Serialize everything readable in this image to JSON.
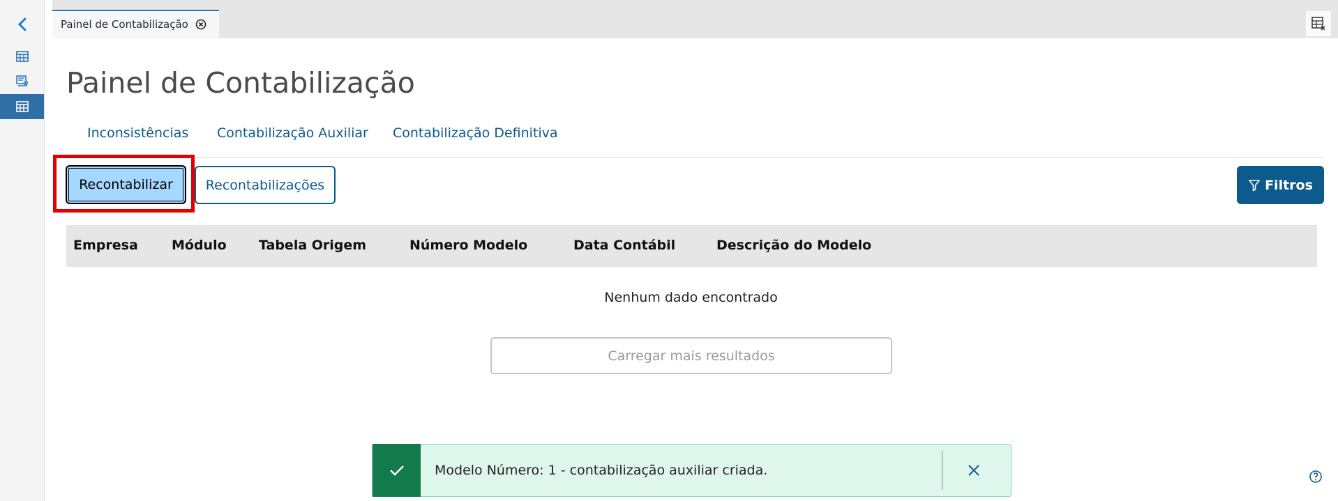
{
  "tab": {
    "label": "Painel de Contabilização"
  },
  "page": {
    "title": "Painel de Contabilização"
  },
  "nav_tabs": [
    {
      "label": "Inconsistências"
    },
    {
      "label": "Contabilização Auxiliar"
    },
    {
      "label": "Contabilização Definitiva"
    }
  ],
  "actions": {
    "recontabilizar": "Recontabilizar",
    "recontabilizacoes": "Recontabilizações",
    "filtros": "Filtros"
  },
  "table": {
    "columns": [
      "Empresa",
      "Módulo",
      "Tabela Origem",
      "Número Modelo",
      "Data Contábil",
      "Descrição do Modelo"
    ],
    "empty_message": "Nenhum dado encontrado",
    "load_more": "Carregar mais resultados"
  },
  "toast": {
    "message": "Modelo Número: 1 - contabilização auxiliar criada."
  },
  "colors": {
    "primary": "#0c5b8c",
    "highlight": "#e30000",
    "success": "#137a4c",
    "selected_button": "#a6d8ff"
  }
}
